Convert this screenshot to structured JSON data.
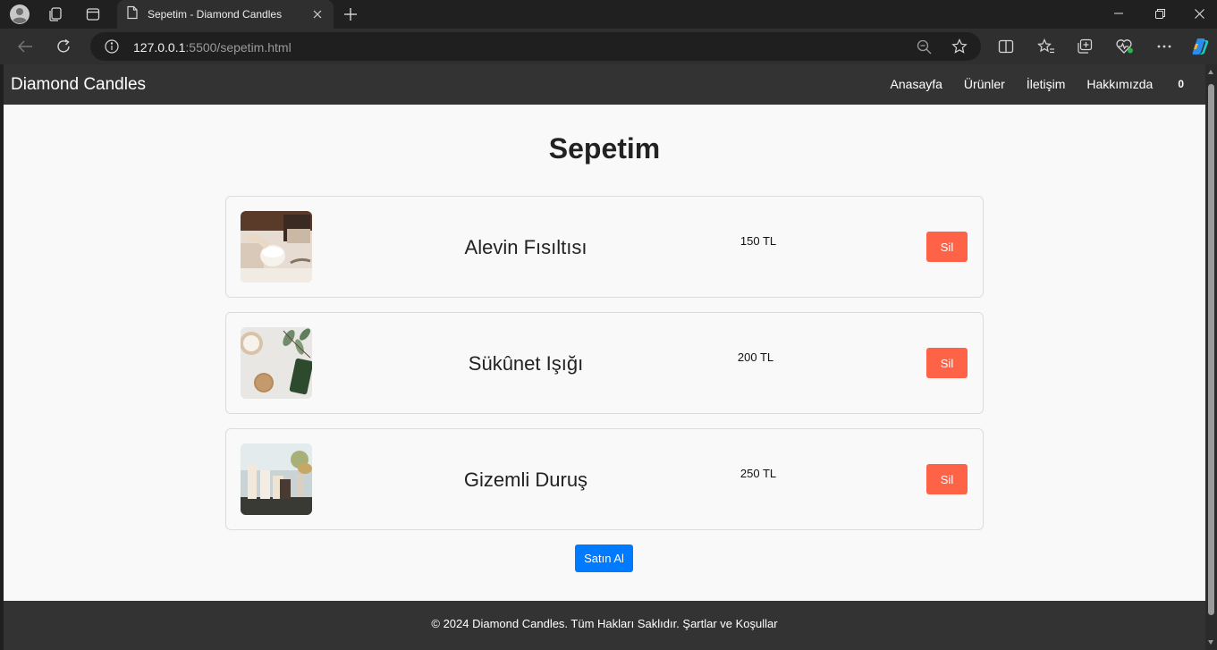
{
  "browser": {
    "tab_title": "Sepetim - Diamond Candles",
    "url_host": "127.0.0.1",
    "url_path": ":5500/sepetim.html"
  },
  "site": {
    "logo": "Diamond Candles",
    "nav": [
      "Anasayfa",
      "Ürünler",
      "İletişim",
      "Hakkımızda"
    ],
    "cart_count": "0"
  },
  "page": {
    "title": "Sepetim",
    "items": [
      {
        "name": "Alevin Fısıltısı",
        "price": "150 TL",
        "delete_label": "Sil",
        "image": "candle-photo-1"
      },
      {
        "name": "Sükûnet Işığı",
        "price": "200 TL",
        "delete_label": "Sil",
        "image": "candle-photo-2"
      },
      {
        "name": "Gizemli Duruş",
        "price": "250 TL",
        "delete_label": "Sil",
        "image": "candle-photo-3"
      }
    ],
    "buy_label": "Satın Al"
  },
  "footer": {
    "text": "© 2024 Diamond Candles. Tüm Hakları Saklıdır. Şartlar ve Koşullar"
  },
  "colors": {
    "header_bg": "#333333",
    "delete_button": "#ff6347",
    "buy_button": "#007bff",
    "page_bg": "#f9f9f9"
  }
}
